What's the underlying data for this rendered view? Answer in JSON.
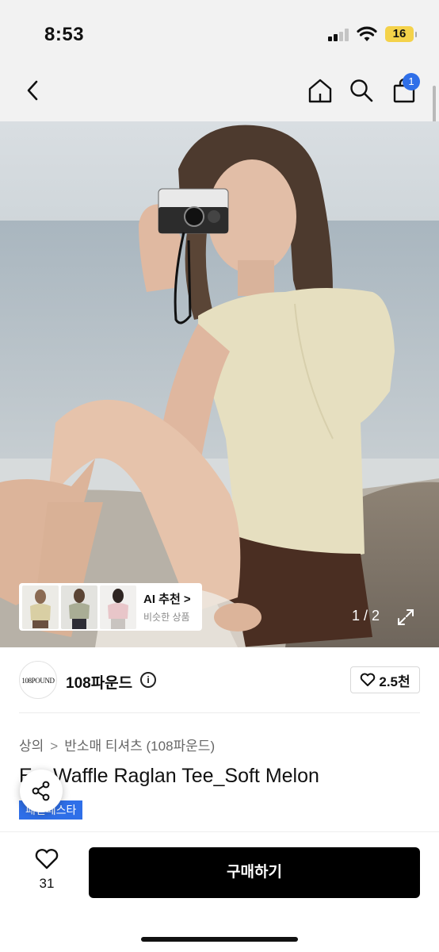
{
  "status_bar": {
    "time": "8:53",
    "battery": "16"
  },
  "nav": {
    "cart_count": "1",
    "icons": [
      "back-icon",
      "home-icon",
      "search-icon",
      "cart-icon"
    ]
  },
  "hero": {
    "counter": "1 / 2",
    "ai_card": {
      "title": "AI 추천 >",
      "subtitle": "비슷한 상품"
    }
  },
  "brand": {
    "logo_text": "108POUND",
    "name": "108파운드",
    "likes": "2.5천"
  },
  "breadcrumb": {
    "category": "상의",
    "separator": ">",
    "subcategory": "반소매 티셔츠 (108파운드)"
  },
  "product": {
    "title": "E  y Waffle Raglan Tee_Soft Melon",
    "tag": "패션페스타"
  },
  "bottom_bar": {
    "like_count": "31",
    "buy_label": "구매하기"
  },
  "colors": {
    "accent": "#2f6fe8",
    "buy_button": "#000000",
    "tee": "#e6dfc0",
    "shorts": "#4a2e22"
  }
}
